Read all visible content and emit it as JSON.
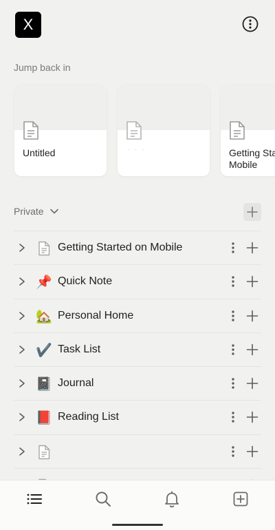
{
  "workspace": {
    "icon_letter": "X"
  },
  "recent": {
    "section_label": "Jump back in",
    "cards": [
      {
        "title": "Untitled",
        "icon": "doc-icon"
      },
      {
        "title": "",
        "icon": "doc-icon"
      },
      {
        "title": "Getting Started on Mobile",
        "icon": "doc-icon"
      }
    ]
  },
  "private": {
    "label": "Private",
    "pages": [
      {
        "emoji": "",
        "icon": "doc-icon",
        "label": "Getting Started on Mobile"
      },
      {
        "emoji": "📌",
        "icon": "pushpin-icon",
        "label": "Quick Note"
      },
      {
        "emoji": "🏡",
        "icon": "house-icon",
        "label": "Personal Home"
      },
      {
        "emoji": "✔️",
        "icon": "check-icon",
        "label": "Task List"
      },
      {
        "emoji": "📓",
        "icon": "notebook-icon",
        "label": "Journal"
      },
      {
        "emoji": "📕",
        "icon": "book-icon",
        "label": "Reading List"
      },
      {
        "emoji": "",
        "icon": "doc-icon",
        "label": ""
      },
      {
        "emoji": "",
        "icon": "doc-icon",
        "label": ""
      }
    ]
  },
  "nav": {
    "items": [
      "home-list-icon",
      "search-icon",
      "bell-icon",
      "new-page-icon"
    ]
  },
  "colors": {
    "background": "#f1f1ef",
    "text": "#37352f",
    "muted": "#7d7a75",
    "card": "#ffffff"
  }
}
